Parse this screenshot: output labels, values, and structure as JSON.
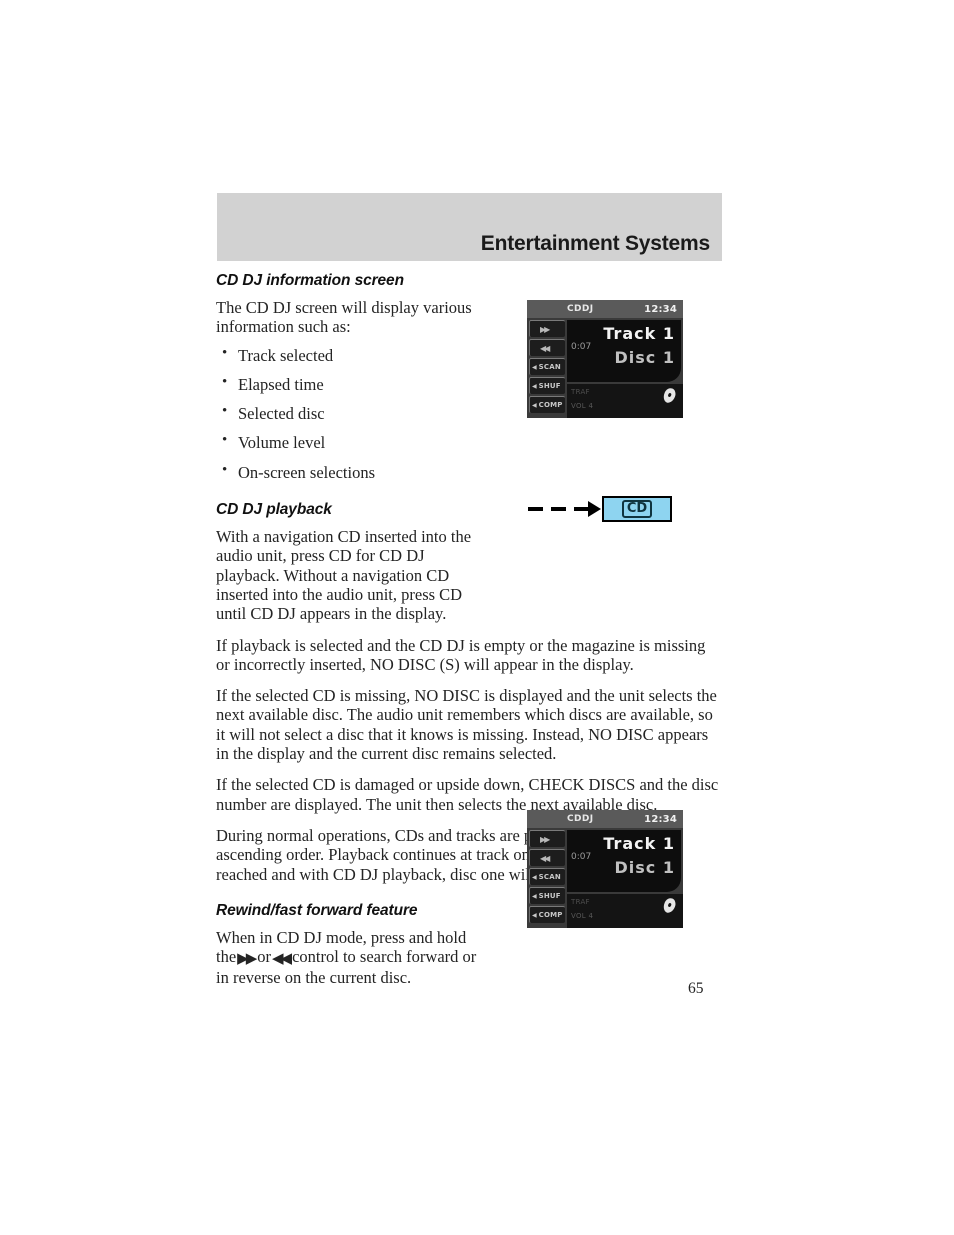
{
  "header": {
    "title": "Entertainment Systems",
    "band_color": "#d2d2d2"
  },
  "sections": [
    {
      "heading": "CD DJ information screen",
      "intro": "The CD DJ screen will display various information such as:",
      "bullets": [
        "Track selected",
        "Elapsed time",
        "Selected disc",
        "Volume level",
        "On-screen selections"
      ]
    },
    {
      "heading": "CD DJ playback",
      "paragraphs": [
        "With a navigation CD inserted into the audio unit, press CD for CD DJ playback. Without a navigation CD inserted into the audio unit, press CD until CD DJ appears in the display.",
        "If playback is selected and the CD DJ is empty or the magazine is missing or incorrectly inserted, NO DISC (S) will appear in the display.",
        "If the selected CD is missing, NO DISC is displayed and the unit selects the next available disc. The audio unit remembers which discs are available, so it will not select a disc that it knows is missing. Instead, NO DISC appears in the display and the current disc remains selected.",
        "If the selected CD is damaged or upside down, CHECK DISCS and the disc number are displayed. The unit then selects the next available disc.",
        "During normal operations, CDs and tracks are played sequentially in ascending order. Playback continues at track one if the end of a disc is reached and with CD DJ playback, disc one will follow disc six."
      ]
    },
    {
      "heading": "Rewind/fast forward feature",
      "text_part1": "When in CD DJ mode, press and hold the",
      "forward_glyph": "▶▶",
      "text_part2": "or",
      "rewind_glyph": "◀◀",
      "text_part3": "control to search forward or in reverse on the current disc."
    }
  ],
  "display_unit": {
    "mode": "CDDJ",
    "time": "12:34",
    "elapsed": "0:07",
    "track_line": "Track 1",
    "disc_line": "Disc 1",
    "traffic_label": "TRAF",
    "volume_label": "VOL 4",
    "buttons": [
      {
        "name": "fast-forward",
        "label": "▶▶",
        "has_marker": false
      },
      {
        "name": "rewind",
        "label": "◀◀",
        "has_marker": false
      },
      {
        "name": "scan",
        "label": "SCAN",
        "has_marker": true
      },
      {
        "name": "shuffle",
        "label": "SHUF",
        "has_marker": true
      },
      {
        "name": "compress",
        "label": "COMP",
        "has_marker": true
      }
    ],
    "disc_icon": "disc-icon"
  },
  "cd_diagram": {
    "button_label": "CD",
    "button_color": "#8ed4f0",
    "arrow": "dashed-arrow"
  },
  "page_number": "65"
}
